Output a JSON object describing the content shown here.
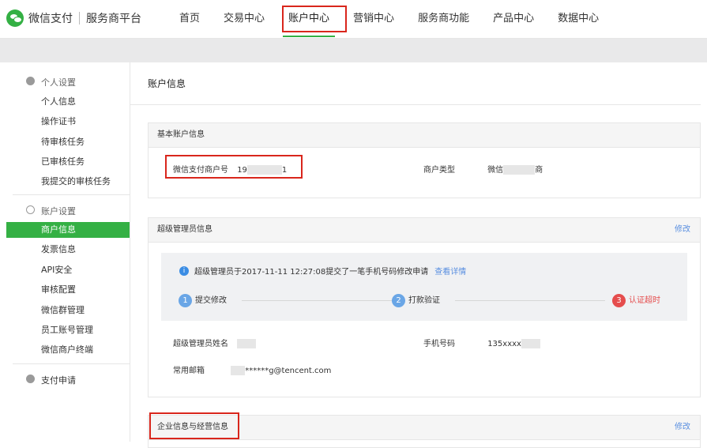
{
  "brand": {
    "product": "微信支付",
    "platform": "服务商平台"
  },
  "nav": [
    "首页",
    "交易中心",
    "账户中心",
    "营销中心",
    "服务商功能",
    "产品中心",
    "数据中心"
  ],
  "sidebar": {
    "personal_title": "个人设置",
    "personal_items": [
      "个人信息",
      "操作证书",
      "待审核任务",
      "已审核任务",
      "我提交的审核任务"
    ],
    "account_title": "账户设置",
    "account_items": [
      "商户信息",
      "发票信息",
      "API安全",
      "审核配置",
      "微信群管理",
      "员工账号管理",
      "微信商户终端"
    ],
    "pay_title": "支付申请"
  },
  "page": {
    "title": "账户信息"
  },
  "basic": {
    "title": "基本账户信息",
    "merchant_label": "微信支付商户号",
    "merchant_prefix": "19",
    "merchant_suffix": "1",
    "type_label": "商户类型",
    "type_value_prefix": "微信",
    "type_value_suffix": "商"
  },
  "admin": {
    "title": "超级管理员信息",
    "edit": "修改",
    "notice": "超级管理员于2017-11-11 12:27:08提交了一笔手机号码修改申请",
    "notice_link": "查看详情",
    "steps": [
      {
        "num": "1",
        "label": "提交修改"
      },
      {
        "num": "2",
        "label": "打款验证"
      },
      {
        "num": "3",
        "label": "认证超时"
      }
    ],
    "name_label": "超级管理员姓名",
    "phone_label": "手机号码",
    "phone_value": "135xxxx",
    "email_label": "常用邮箱",
    "email_value": "******g@tencent.com"
  },
  "company": {
    "title": "企业信息与经营信息",
    "edit": "修改"
  }
}
